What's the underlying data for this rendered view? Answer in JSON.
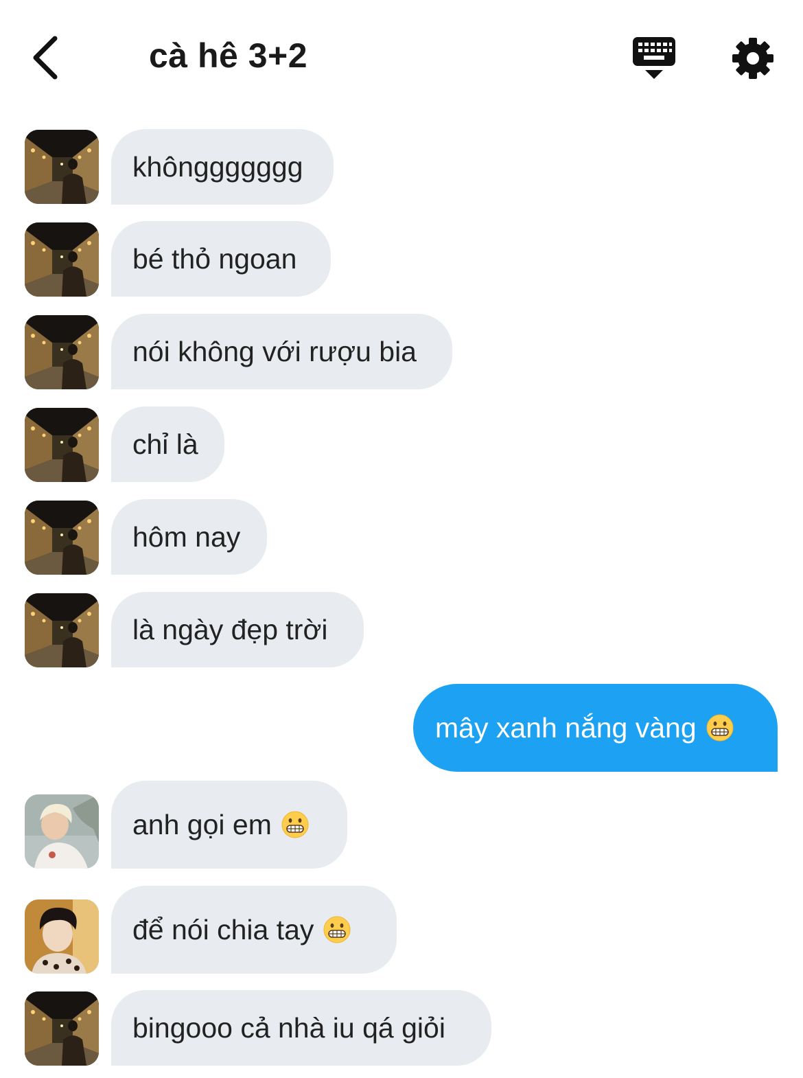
{
  "header": {
    "title": "cà hê 3+2"
  },
  "icons": {
    "back": "chevron-left-icon",
    "keyboard": "keyboard-hide-icon",
    "settings": "gear-icon"
  },
  "colors": {
    "incoming_bubble": "#e8ebef",
    "outgoing_bubble": "#1da1f2",
    "outgoing_text": "#ffffff"
  },
  "messages": [
    {
      "text": "khônggggggg",
      "direction": "incoming",
      "avatar": "avatar-street-night",
      "emoji": false
    },
    {
      "text": "bé thỏ ngoan",
      "direction": "incoming",
      "avatar": "avatar-street-night",
      "emoji": false
    },
    {
      "text": "nói không với rượu bia",
      "direction": "incoming",
      "avatar": "avatar-street-night",
      "emoji": false
    },
    {
      "text": "chỉ là",
      "direction": "incoming",
      "avatar": "avatar-street-night",
      "emoji": false
    },
    {
      "text": "hôm nay",
      "direction": "incoming",
      "avatar": "avatar-street-night",
      "emoji": false
    },
    {
      "text": "là ngày đẹp trời",
      "direction": "incoming",
      "avatar": "avatar-street-night",
      "emoji": false
    },
    {
      "text": "mây xanh nắng vàng",
      "direction": "outgoing",
      "emoji": true
    },
    {
      "text": "anh gọi em",
      "direction": "incoming",
      "avatar": "avatar-blond-person",
      "emoji": true
    },
    {
      "text": "để nói chia tay",
      "direction": "incoming",
      "avatar": "avatar-dark-hair-person",
      "emoji": true
    },
    {
      "text": "bingooo cả nhà iu qá giỏi",
      "direction": "incoming",
      "avatar": "avatar-street-night",
      "emoji": false
    }
  ]
}
